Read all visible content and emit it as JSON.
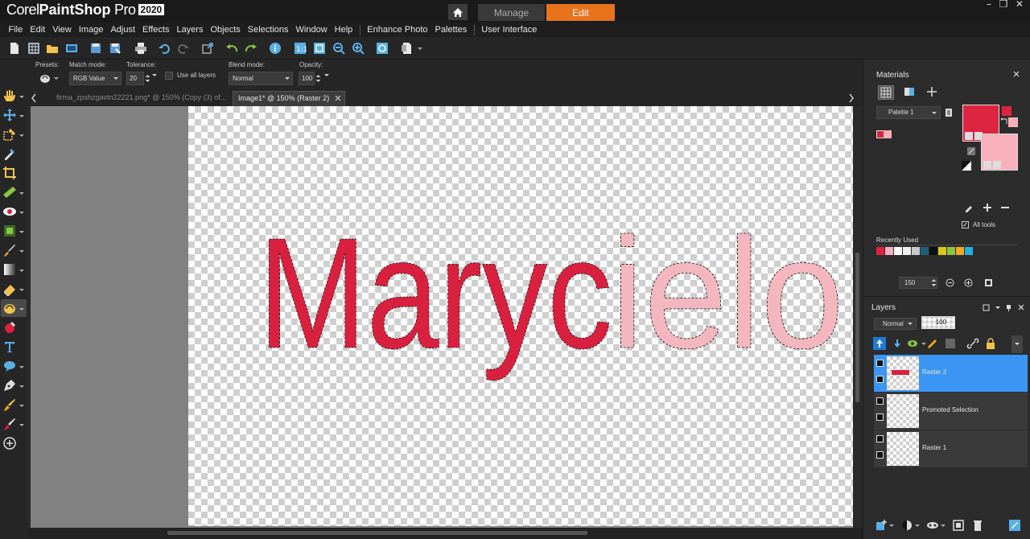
{
  "app": {
    "brand_light": "Corel",
    "brand_bold": "PaintShop",
    "brand_pro": " Pro",
    "year": "2020"
  },
  "workspace_tabs": {
    "manage": "Manage",
    "edit": "Edit"
  },
  "menu": [
    "File",
    "Edit",
    "View",
    "Image",
    "Adjust",
    "Effects",
    "Layers",
    "Objects",
    "Selections",
    "Window",
    "Help",
    "Enhance Photo",
    "Palettes",
    "User Interface"
  ],
  "options": {
    "presets_label": "Presets:",
    "match_mode_label": "Match mode:",
    "match_mode_value": "RGB Value",
    "tolerance_label": "Tolerance:",
    "tolerance_value": "20",
    "use_all_layers_label": "Use all layers",
    "use_all_layers_checked": false,
    "blend_mode_label": "Blend mode:",
    "blend_mode_value": "Normal",
    "opacity_label": "Opacity:",
    "opacity_value": "100"
  },
  "doc_tabs": [
    {
      "label": "firma_zpshzgavtn22221.png* @ 150% (Copy (3) of...",
      "active": false
    },
    {
      "label": "Image1* @ 150% (Raster 2)",
      "active": true
    }
  ],
  "canvas": {
    "text_dark": "Maryc",
    "text_light": "ielo",
    "color_dark": "#d9203f",
    "color_light": "#f5b7bf"
  },
  "materials": {
    "title": "Materials",
    "palette_value": "Palette 1",
    "all_tools_label": "All tools",
    "all_tools_checked": true,
    "recently_used_label": "Recently Used",
    "zoom_value": "150",
    "foreground_color": "#dc2440",
    "background_color": "#f8b0bb",
    "recent_colors": [
      "#e0223f",
      "#f5b2be",
      "#ffffff",
      "#f0f0f0",
      "#c8c8c8",
      "#1f5f7c",
      "#101010",
      "#d8c81c",
      "#8bc63f",
      "#f7a81c",
      "#1eb0e6"
    ]
  },
  "layers": {
    "title": "Layers",
    "blend_value": "Normal",
    "opacity_value": "100",
    "items": [
      {
        "name": "Raster 2",
        "active": true
      },
      {
        "name": "Promoted Selection",
        "active": false
      },
      {
        "name": "Raster 1",
        "active": false
      }
    ]
  }
}
